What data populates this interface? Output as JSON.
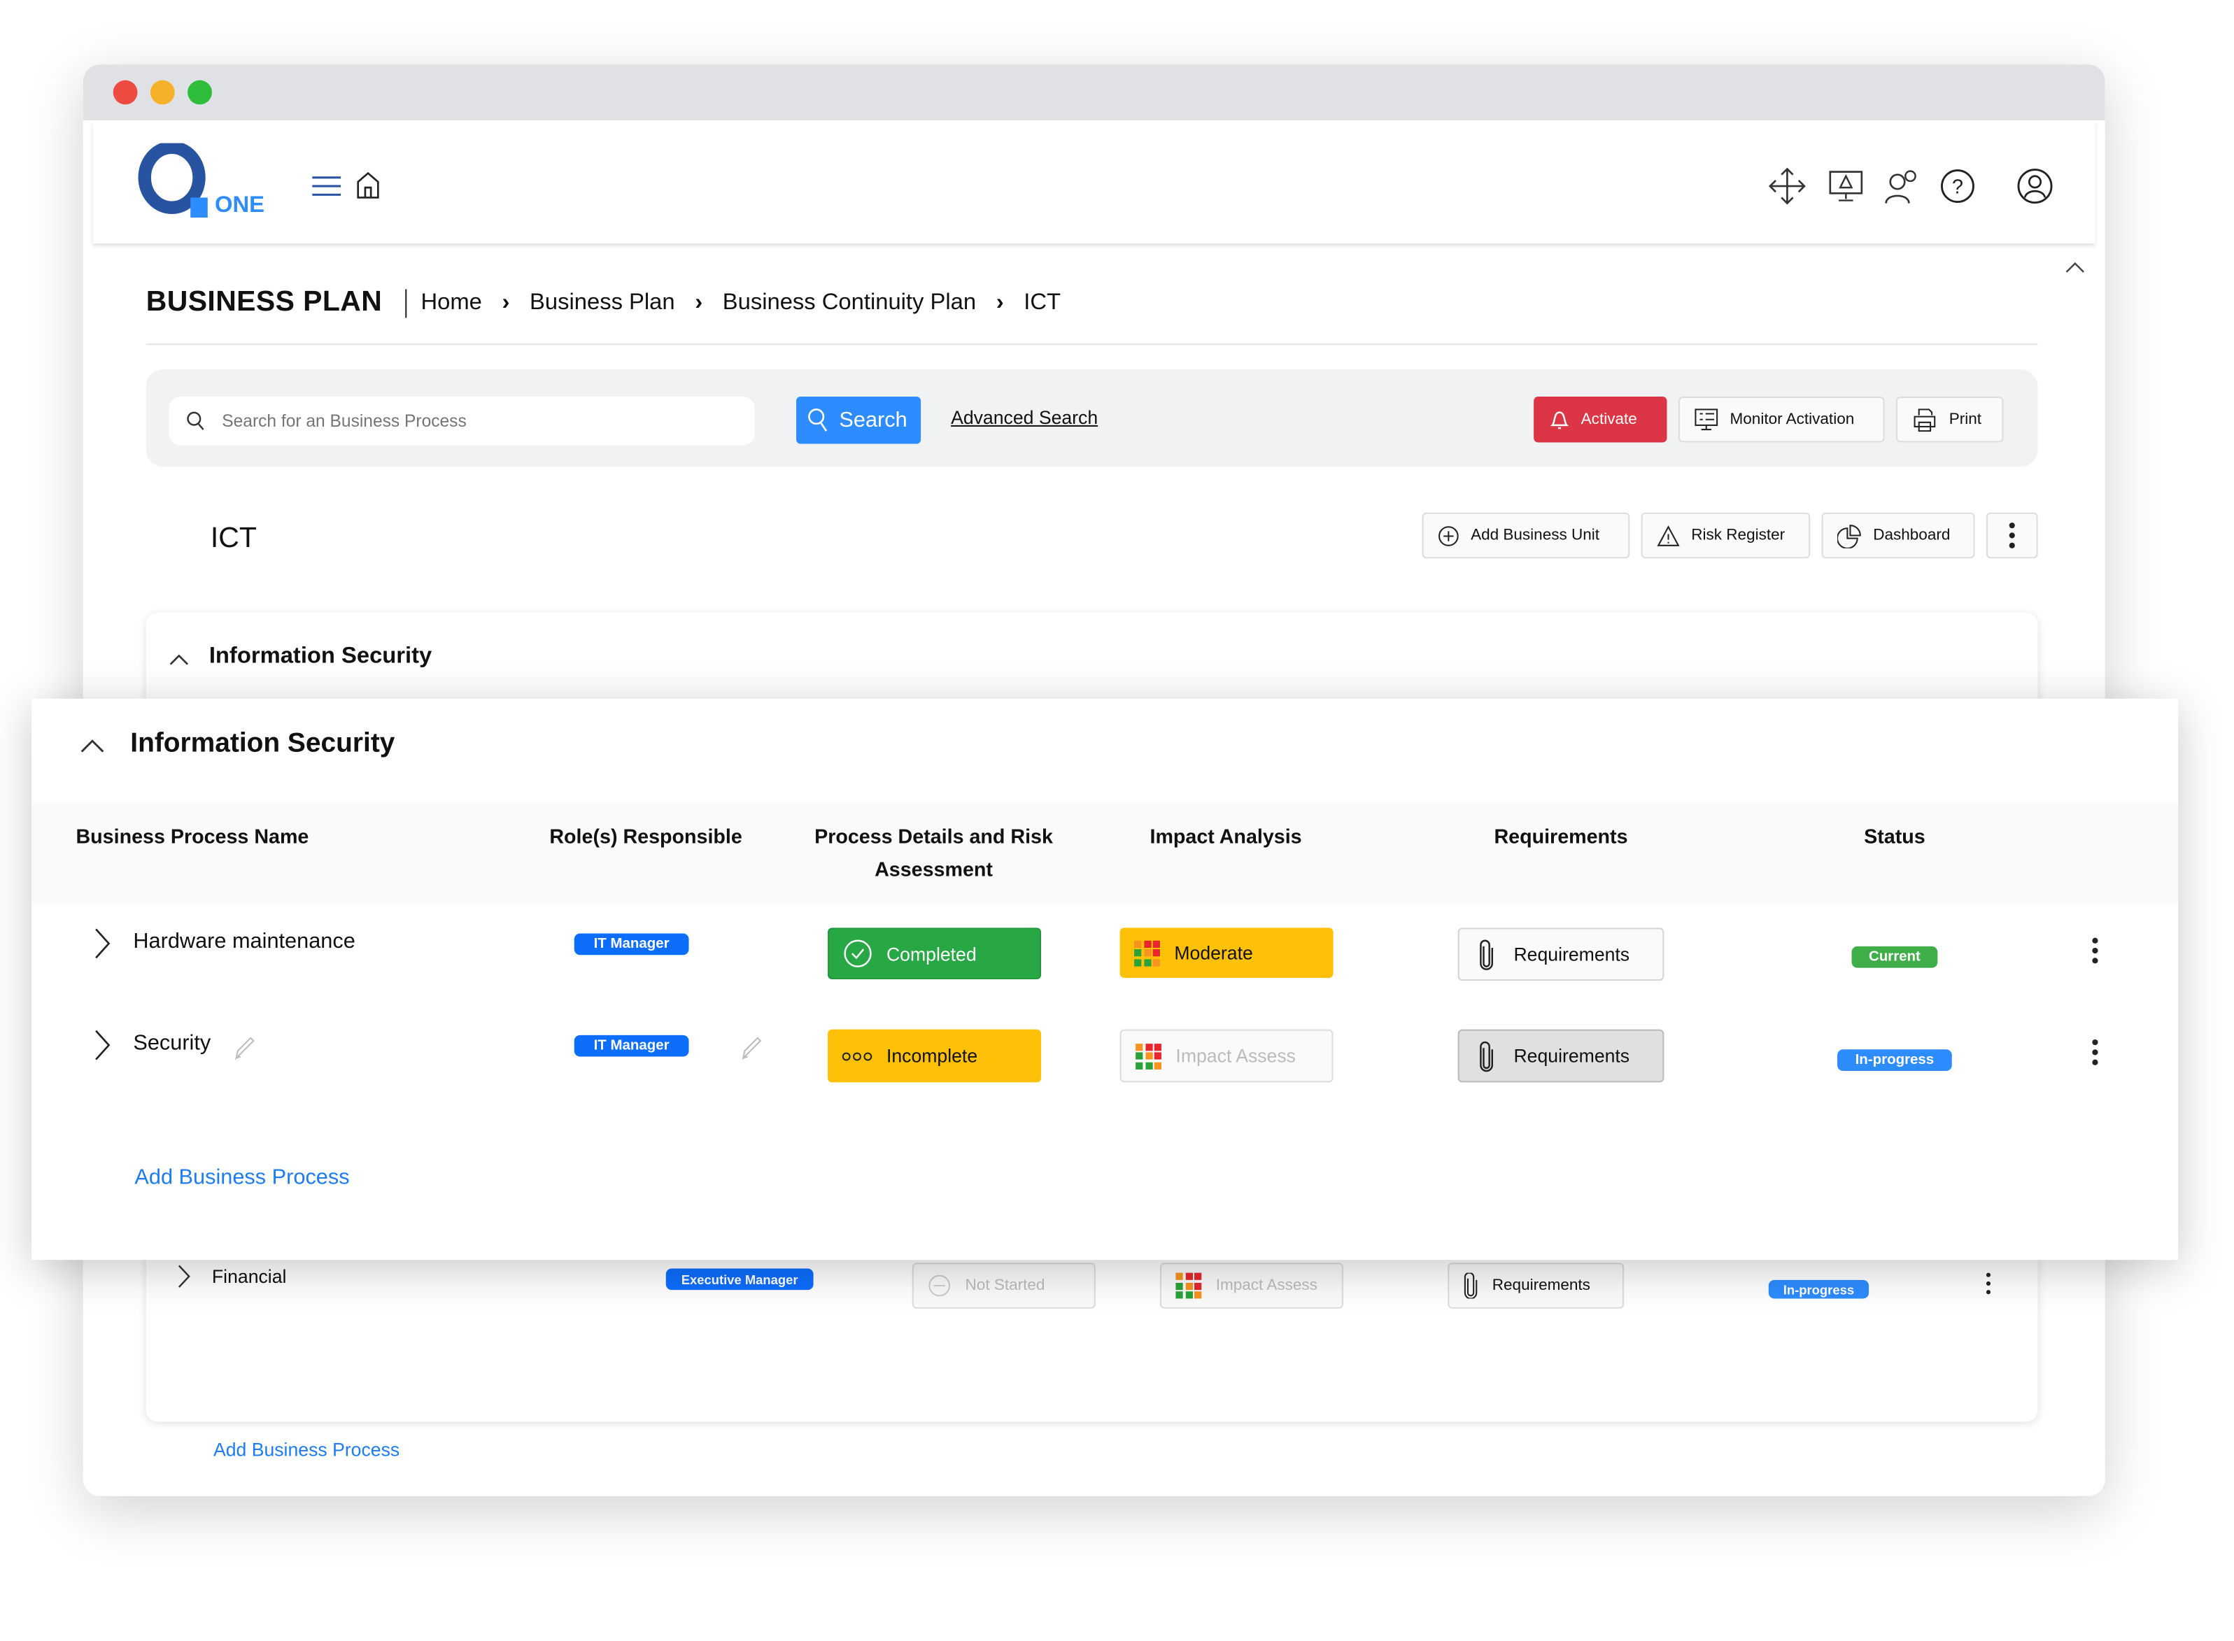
{
  "app": {
    "logo_text": "ONE"
  },
  "header_icons": [
    "move-arrows-icon",
    "monitor-alert-icon",
    "user-settings-icon",
    "help-icon",
    "user-profile-icon"
  ],
  "page": {
    "title": "BUSINESS PLAN",
    "breadcrumb": [
      "Home",
      "Business Plan",
      "Business Continuity Plan",
      "ICT"
    ]
  },
  "search": {
    "placeholder": "Search for an Business Process",
    "value": "",
    "button_label": "Search",
    "advanced_label": "Advanced Search"
  },
  "toolbar": {
    "activate": "Activate",
    "monitor": "Monitor Activation",
    "print": "Print"
  },
  "unit": {
    "title": "ICT",
    "actions": {
      "add_unit": "Add Business Unit",
      "risk_register": "Risk Register",
      "dashboard": "Dashboard"
    }
  },
  "section": {
    "title": "Information Security",
    "columns": [
      "Business Process Name",
      "Role(s) Responsible",
      "Process Details and Risk Assessment",
      "Impact Analysis",
      "Requirements",
      "Status"
    ],
    "rows": [
      {
        "name": "Hardware maintenance",
        "role": "IT Manager",
        "process": "Completed",
        "impact": "Moderate",
        "requirements": "Requirements",
        "status": "Current"
      },
      {
        "name": "Security",
        "role": "IT Manager",
        "process": "Incomplete",
        "impact": "Impact Assess",
        "requirements": "Requirements",
        "status": "In-progress"
      }
    ],
    "add_label": "Add Business Process"
  },
  "background_section": {
    "title": "Information Security",
    "row": {
      "name": "Financial",
      "role": "Executive Manager",
      "process": "Not Started",
      "impact": "Impact Assess",
      "requirements": "Requirements",
      "status": "In-progress"
    },
    "add_label": "Add Business Process"
  },
  "colors": {
    "brand": "#2853a0",
    "accent": "#2d8cff",
    "danger": "#dc3545",
    "success": "#28a745",
    "warning": "#ffc107",
    "badge_blue": "#0d6efd"
  }
}
